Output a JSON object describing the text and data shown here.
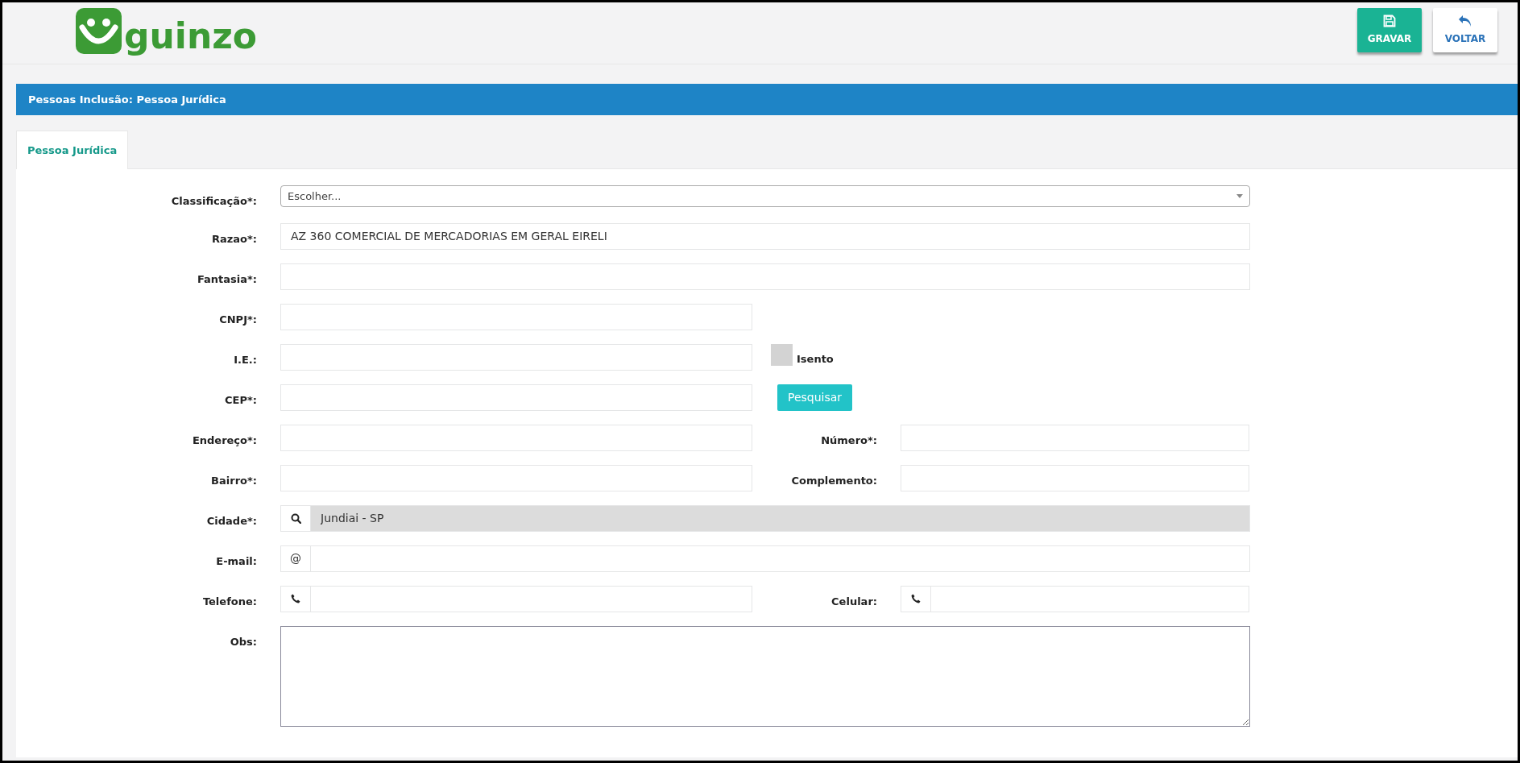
{
  "header": {
    "logo_text": "guinzo",
    "buttons": [
      {
        "kind": "save",
        "label": "GRAVAR"
      },
      {
        "kind": "back",
        "label": "VOLTAR"
      }
    ]
  },
  "title_bar": "Pessoas Inclusão: Pessoa Jurídica",
  "tabs": [
    {
      "label": "Pessoa Jurídica",
      "selected": true
    }
  ],
  "form": {
    "rows": [
      {
        "fields": [
          {
            "label": "Classificação*:",
            "kind": "select",
            "value": "Escolher..."
          }
        ]
      },
      {
        "fields": [
          {
            "label": "Razao*:",
            "kind": "text",
            "value": "AZ 360 COMERCIAL DE MERCADORIAS EM GERAL EIRELI"
          }
        ]
      },
      {
        "fields": [
          {
            "label": "Fantasia*:",
            "kind": "text"
          }
        ]
      },
      {
        "fields": [
          {
            "label": "CNPJ*:",
            "kind": "short"
          }
        ]
      },
      {
        "fields": [
          {
            "label": "I.E.:",
            "kind": "short"
          }
        ],
        "extra": {
          "kind": "checkbox",
          "label": "Isento",
          "checked": false
        }
      },
      {
        "fields": [
          {
            "label": "CEP*:",
            "kind": "short"
          }
        ],
        "extra": {
          "kind": "button",
          "label": "Pesquisar"
        }
      },
      {
        "fields": [
          {
            "label": "Endereço*:",
            "kind": "short"
          },
          {
            "label": "Número*:",
            "kind": "text"
          }
        ]
      },
      {
        "fields": [
          {
            "label": "Bairro*:",
            "kind": "short"
          },
          {
            "label": "Complemento:",
            "kind": "text"
          }
        ]
      },
      {
        "fields": [
          {
            "label": "Cidade*:",
            "kind": "search",
            "value": "Jundiai - SP",
            "disabled": true
          }
        ]
      },
      {
        "fields": [
          {
            "label": "E-mail:",
            "kind": "prefixed",
            "prefix": "@",
            "disabled": false
          }
        ]
      },
      {
        "fields": [
          {
            "label": "Telefone:",
            "kind": "phone",
            "disabled": false
          },
          {
            "label": "Celular:",
            "kind": "phone",
            "disabled": false
          }
        ]
      },
      {
        "fields": [
          {
            "label": "Obs:",
            "kind": "textarea"
          }
        ]
      }
    ]
  }
}
